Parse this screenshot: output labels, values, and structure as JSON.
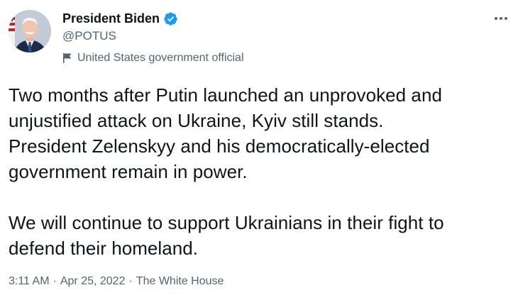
{
  "author": {
    "display_name": "President Biden",
    "handle": "@POTUS",
    "label": "United States government official"
  },
  "tweet": {
    "text": "Two months after Putin launched an unprovoked and\nunjustified attack on Ukraine, Kyiv still stands.\nPresident Zelenskyy and his democratically-elected\ngovernment remain in power.\n\nWe will continue to support Ukrainians in their fight to\ndefend their homeland.",
    "time": "3:11 AM",
    "date": "Apr 25, 2022",
    "source": "The White House",
    "separator": "·"
  },
  "icons": {
    "verified": "verified-badge-icon",
    "label": "flag-icon",
    "more": "more-icon"
  },
  "colors": {
    "text": "#0f1419",
    "secondary": "#536471",
    "verified": "#1d9bf0"
  }
}
